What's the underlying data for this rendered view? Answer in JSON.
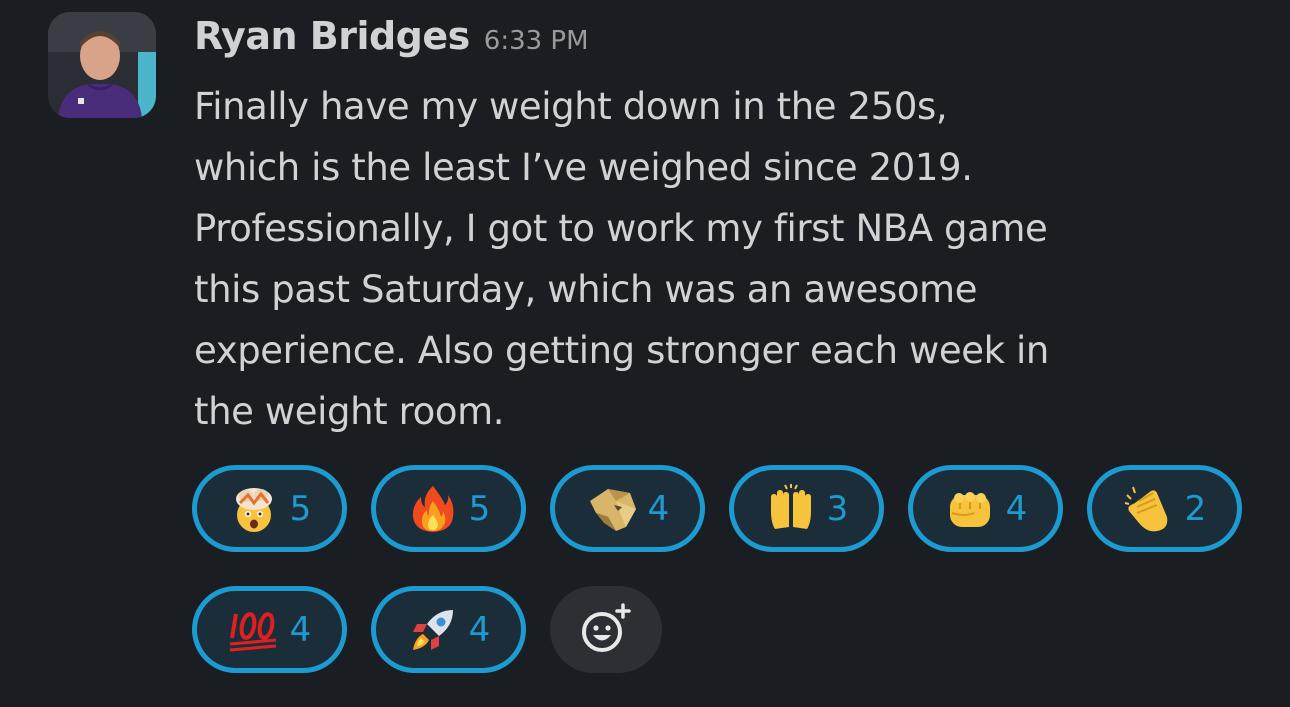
{
  "message": {
    "author": "Ryan Bridges",
    "timestamp": "6:33 PM",
    "avatar_icon": "user-avatar",
    "body_lines": [
      "Finally have my weight down in the 250s,",
      "which is the least I’ve weighed since 2019.",
      "Professionally, I got to work my first NBA game",
      "this past Saturday, which was an awesome",
      "experience. Also getting stronger each week in",
      "the weight room."
    ]
  },
  "reactions": [
    {
      "emoji": "exploding-head",
      "count": "5"
    },
    {
      "emoji": "fire",
      "count": "5"
    },
    {
      "emoji": "gold-lion-logo",
      "count": "4"
    },
    {
      "emoji": "raised-hands",
      "count": "3"
    },
    {
      "emoji": "oncoming-fist",
      "count": "4"
    },
    {
      "emoji": "clapping-hands",
      "count": "2"
    },
    {
      "emoji": "hundred-points",
      "count": "4"
    },
    {
      "emoji": "rocket",
      "count": "4"
    }
  ],
  "add_reaction": {
    "icon": "add-emoji-reaction"
  },
  "colors": {
    "background": "#1a1d21",
    "text": "#d1d2d3",
    "timestamp": "#9a9b9d",
    "reaction_border": "#1d9bd1",
    "reaction_bg": "#1c2d3a"
  }
}
